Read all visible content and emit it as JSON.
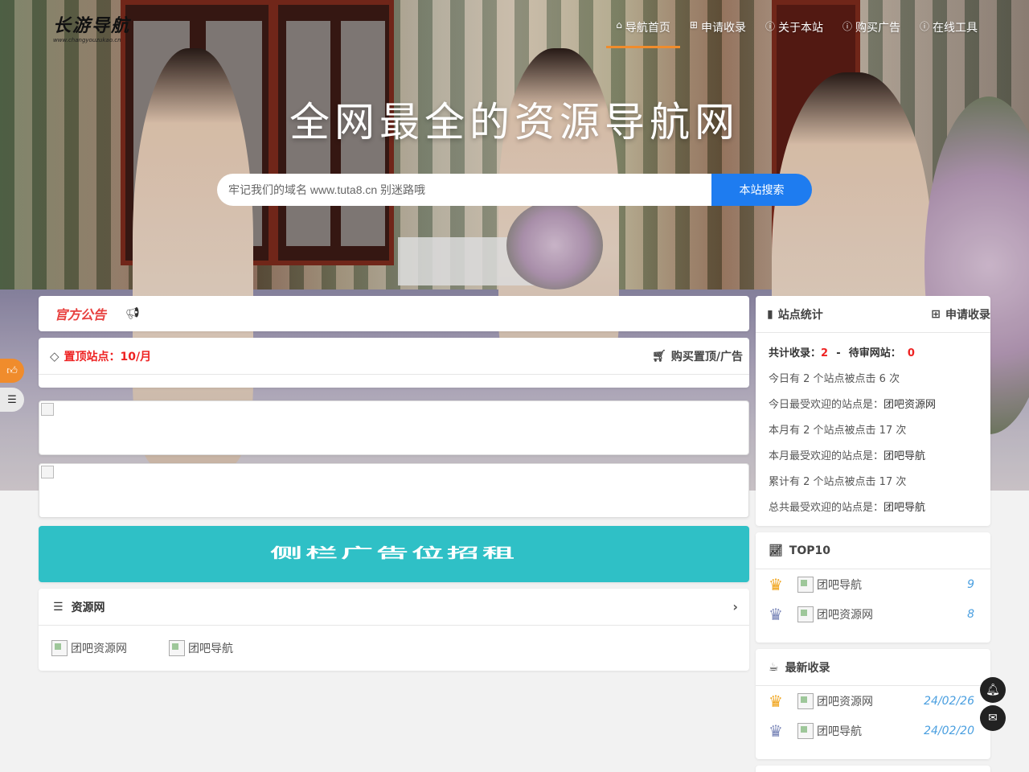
{
  "site": {
    "logo_text": "长游导航",
    "logo_sub": "www.changyouzukao.cn"
  },
  "nav": {
    "items": [
      {
        "icon": "home-icon",
        "label": "导航首页",
        "active": true
      },
      {
        "icon": "plus-square-icon",
        "label": "申请收录"
      },
      {
        "icon": "info-icon",
        "label": "关于本站"
      },
      {
        "icon": "info-icon",
        "label": "购买广告"
      },
      {
        "icon": "info-icon",
        "label": "在线工具"
      }
    ]
  },
  "hero": {
    "title": "全网最全的资源导航网",
    "search_placeholder": "牢记我们的域名 www.tuta8.cn 别迷路哦",
    "search_button": "本站搜索"
  },
  "notice": {
    "badge": "官方公告"
  },
  "pinned": {
    "label": "置顶站点：10/月",
    "buy_label": "购买置顶/广告"
  },
  "ad_strip": {
    "text": "侧栏广告位招租"
  },
  "resources": {
    "title": "资源网",
    "sites": [
      "团吧资源网",
      "团吧导航"
    ]
  },
  "stats": {
    "title": "站点统计",
    "apply_label": "申请收录",
    "total_label": "共计收录：",
    "total_value": "2",
    "separator": "-",
    "pending_label": "待审网站：",
    "pending_value": "0",
    "lines": [
      {
        "text": "今日有 2 个站点被点击 6 次"
      },
      {
        "text": "今日最受欢迎的站点是：",
        "site": "团吧资源网"
      },
      {
        "text": "本月有 2 个站点被点击 17 次"
      },
      {
        "text": "本月最受欢迎的站点是：",
        "site": "团吧导航"
      },
      {
        "text": "累计有 2 个站点被点击 17 次"
      },
      {
        "text": "总共最受欢迎的站点是：",
        "site": "团吧导航"
      }
    ]
  },
  "top10": {
    "title": "TOP10",
    "items": [
      {
        "rank_color": "#f0a51e",
        "name": "团吧导航",
        "value": "9"
      },
      {
        "rank_color": "#7a86b8",
        "name": "团吧资源网",
        "value": "8"
      }
    ]
  },
  "newest": {
    "title": "最新收录",
    "items": [
      {
        "rank_color": "#f0a51e",
        "name": "团吧资源网",
        "date": "24/02/26"
      },
      {
        "rank_color": "#7a86b8",
        "name": "团吧导航",
        "date": "24/02/20"
      }
    ]
  },
  "colors": {
    "accent": "#f08c2c",
    "search_button": "#1e7cf0",
    "ad_strip": "#2fc0c6",
    "highlight": "#e22222",
    "value_blue": "#4a9fe0"
  }
}
